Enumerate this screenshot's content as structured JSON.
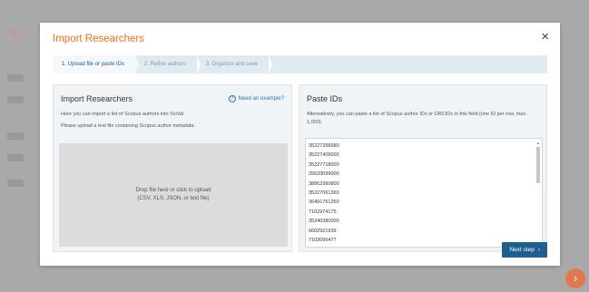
{
  "background": {
    "app_title": "Sc",
    "fab_icon": "chevron-right"
  },
  "modal": {
    "title": "Import Researchers",
    "close_label": "×",
    "steps": [
      {
        "label": "1. Upload file or paste IDs",
        "active": true
      },
      {
        "label": "2. Refine authors",
        "active": false
      },
      {
        "label": "3. Organize and save",
        "active": false
      }
    ],
    "left_panel": {
      "title": "Import Researchers",
      "example_link": "Need an example?",
      "desc_1": "Here you can import a list of Scopus authors into SciVal.",
      "desc_2": "Please upload a text file containing Scopus author metadata.",
      "dropzone_line_1": "Drop file here or click to upload",
      "dropzone_line_2": "(CSV, XLS, JSON, or text file)"
    },
    "right_panel": {
      "title": "Paste IDs",
      "desc": "Alternatively, you can paste a list of Scopus author IDs or ORCIDs in this field (one ID per row, max. 1,000).",
      "ids": [
        "35227266680",
        "35227409000",
        "35227718000",
        "25633099000",
        "38862360800",
        "35227061360",
        "36491761260",
        "7102974175",
        "35240380000",
        "6602921939",
        "7103096477"
      ]
    },
    "next_button": "Next step",
    "next_arrow": "›"
  },
  "colors": {
    "accent": "#e9711c",
    "primary_button": "#1f5f8f",
    "stepper_bg": "#dfeaf1"
  }
}
